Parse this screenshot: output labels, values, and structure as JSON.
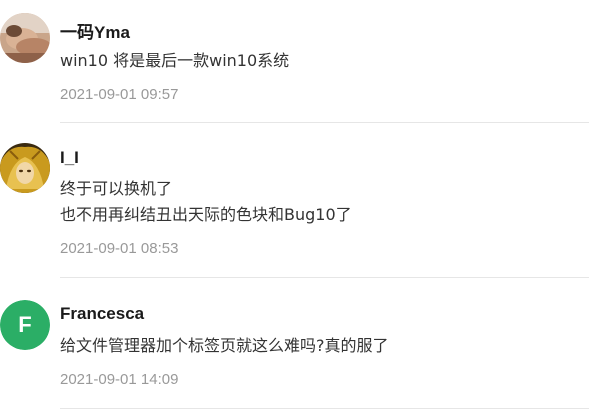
{
  "comments": [
    {
      "author": "一码Yma",
      "lines": [
        "win10 将是最后一款win10系统"
      ],
      "time": "2021-09-01 09:57",
      "avatar": "photo"
    },
    {
      "author": "I_I",
      "lines": [
        "终于可以换机了",
        "也不用再纠结丑出天际的色块和Bug10了"
      ],
      "time": "2021-09-01 08:53",
      "avatar": "photo"
    },
    {
      "author": "Francesca",
      "lines": [
        "给文件管理器加个标签页就这么难吗?真的服了"
      ],
      "time": "2021-09-01 14:09",
      "avatar_letter": "F",
      "avatar_color": "#2bae66"
    }
  ]
}
